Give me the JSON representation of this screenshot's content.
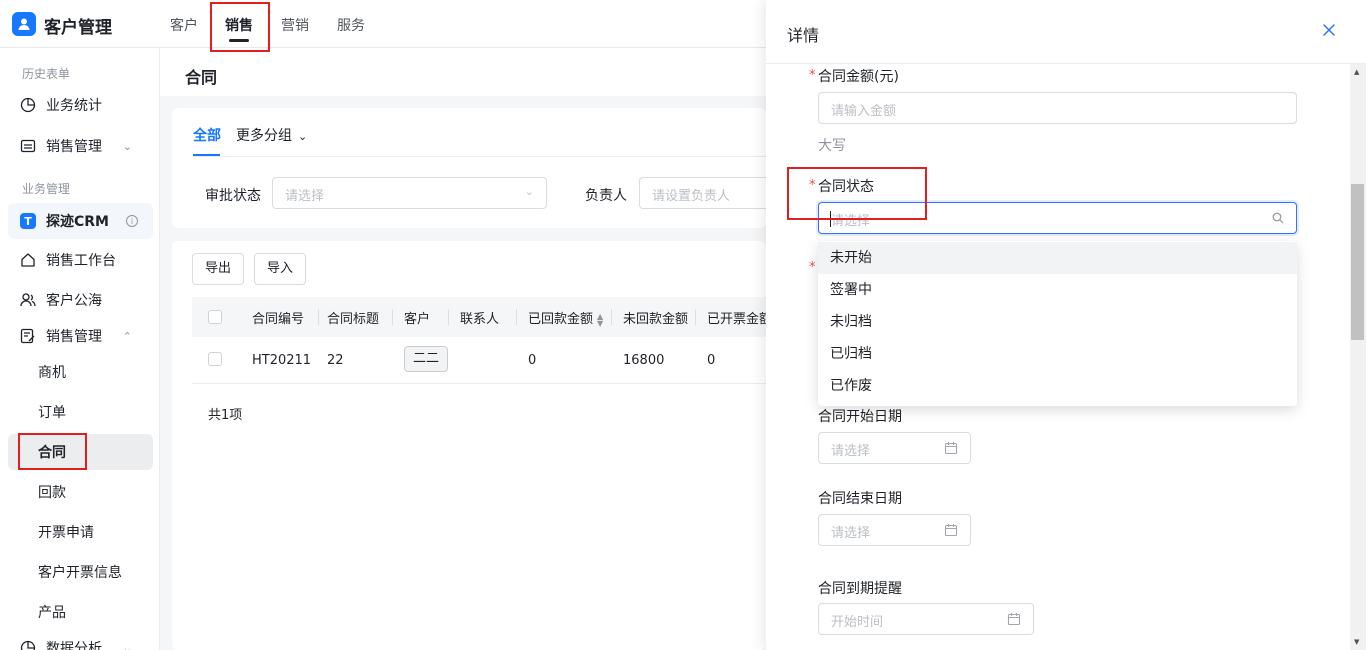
{
  "app": {
    "title": "客户管理"
  },
  "top_tabs": [
    {
      "label": "客户",
      "active": false
    },
    {
      "label": "销售",
      "active": true
    },
    {
      "label": "营销",
      "active": false
    },
    {
      "label": "服务",
      "active": false
    }
  ],
  "sidebar": {
    "group_history": "历史表单",
    "group_business": "业务管理",
    "items": {
      "biz_stats": "业务统计",
      "sales_mgmt_history": "销售管理",
      "crm": "探迹CRM",
      "workbench": "销售工作台",
      "sea": "客户公海",
      "sales_mgmt": "销售管理",
      "data_analysis": "数据分析"
    },
    "sub_items": [
      "商机",
      "订单",
      "合同",
      "回款",
      "开票申请",
      "客户开票信息",
      "产品"
    ],
    "active_sub": "合同"
  },
  "page": {
    "title": "合同",
    "tab_all": "全部",
    "tab_more": "更多分组",
    "filter_approval_label": "审批状态",
    "filter_approval_placeholder": "请选择",
    "filter_owner_label": "负责人",
    "filter_owner_placeholder": "请设置负责人",
    "export_label": "导出",
    "import_label": "导入",
    "columns": [
      "合同编号",
      "合同标题",
      "客户",
      "联系人",
      "已回款金额",
      "未回款金额",
      "已开票金额"
    ],
    "rows": [
      {
        "contract_no": "HT20211",
        "title": "22",
        "customer": "二二",
        "contact": "",
        "received": "0",
        "unreceived": "16800",
        "invoiced": "0"
      }
    ],
    "total": "共1项"
  },
  "drawer": {
    "title": "详情",
    "amount_label": "合同金额(元)",
    "amount_placeholder": "请输入金额",
    "amount_upper_label": "大写",
    "status_label": "合同状态",
    "status_placeholder": "请选择",
    "status_options": [
      "未开始",
      "签署中",
      "未归档",
      "已归档",
      "已作废"
    ],
    "start_date_label": "合同开始日期",
    "start_date_placeholder": "请选择",
    "end_date_label": "合同结束日期",
    "end_date_placeholder": "请选择",
    "expire_remind_label": "合同到期提醒",
    "expire_remind_placeholder": "开始时间"
  },
  "colors": {
    "accent": "#1677ff",
    "highlight_box": "#e02020"
  }
}
